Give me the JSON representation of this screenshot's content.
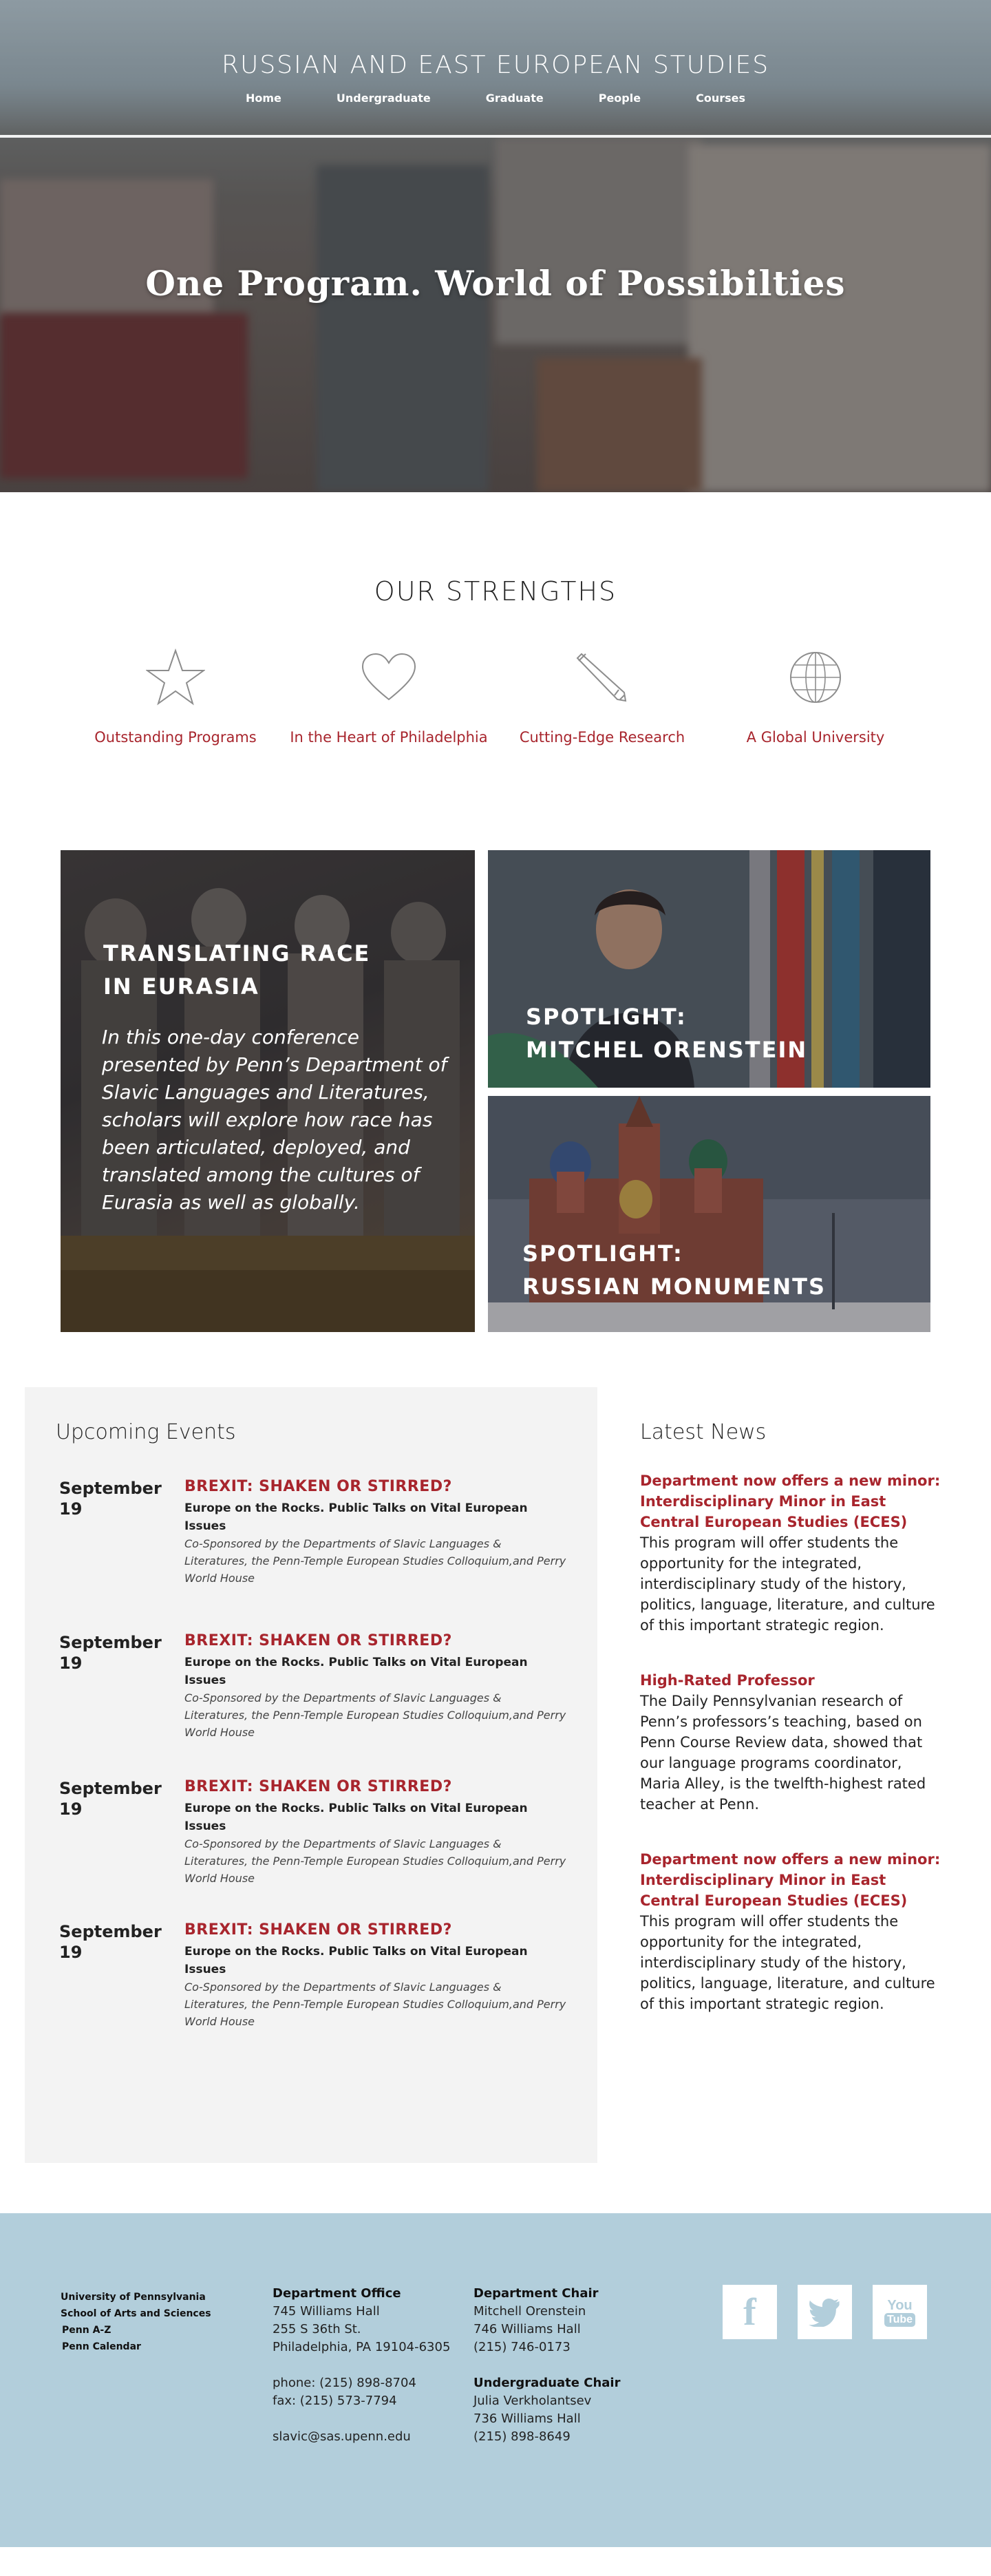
{
  "header": {
    "site_title": "RUSSIAN AND EAST EUROPEAN STUDIES",
    "nav": [
      "Home",
      "Undergraduate",
      "Graduate",
      "People",
      "Courses"
    ],
    "headline": "One Program. World of Possibilties"
  },
  "strengths": {
    "title": "OUR STRENGTHS",
    "items": [
      {
        "icon": "star-icon",
        "label": "Outstanding Programs"
      },
      {
        "icon": "heart-icon",
        "label": "In the Heart of Philadelphia"
      },
      {
        "icon": "pencil-icon",
        "label": "Cutting-Edge Research"
      },
      {
        "icon": "globe-icon",
        "label": "A Global University"
      }
    ]
  },
  "features": {
    "main": {
      "title_line1": "TRANSLATING RACE",
      "title_line2": "IN EURASIA",
      "text": "In this one-day conference presented by Penn’s Department of Slavic Languages and Literatures, scholars will explore how race has been articulated, deployed, and translated among the cultures of Eurasia as well as globally."
    },
    "spotlight1": {
      "line1": "SPOTLIGHT:",
      "line2": "MITCHEL ORENSTEIN"
    },
    "spotlight2": {
      "line1": "SPOTLIGHT:",
      "line2": "RUSSIAN MONUMENTS"
    }
  },
  "events": {
    "title": "Upcoming Events",
    "items": [
      {
        "month": "September",
        "day": "19",
        "title": "BREXIT: SHAKEN OR STIRRED?",
        "subtitle": "Europe on the Rocks. Public Talks on Vital European Issues",
        "note": "Co-Sponsored by the Departments of Slavic Languages & Literatures, the Penn-Temple European Studies Colloquium,and Perry World House"
      },
      {
        "month": "September",
        "day": "19",
        "title": "BREXIT: SHAKEN OR STIRRED?",
        "subtitle": "Europe on the Rocks. Public Talks on Vital European Issues",
        "note": "Co-Sponsored by the Departments of Slavic Languages & Literatures, the Penn-Temple European Studies Colloquium,and Perry World House"
      },
      {
        "month": "September",
        "day": "19",
        "title": "BREXIT: SHAKEN OR STIRRED?",
        "subtitle": "Europe on the Rocks. Public Talks on Vital European Issues",
        "note": "Co-Sponsored by the Departments of Slavic Languages & Literatures, the Penn-Temple European Studies Colloquium,and Perry World House"
      },
      {
        "month": "September",
        "day": "19",
        "title": "BREXIT: SHAKEN OR STIRRED?",
        "subtitle": "Europe on the Rocks. Public Talks on Vital European Issues",
        "note": "Co-Sponsored by the Departments of Slavic Languages & Literatures, the Penn-Temple European Studies Colloquium,and Perry World House"
      }
    ]
  },
  "news": {
    "title": "Latest News",
    "items": [
      {
        "title": "Department now offers a new minor: Interdisciplinary Minor in East Central European Studies (ECES)",
        "text": "This program will offer students the opportunity for the integrated, interdisciplinary study of the history, politics, language, literature, and culture of this important strategic region."
      },
      {
        "title": "High-Rated Professor",
        "text": "The Daily Pennsylvanian research of Penn’s professors’s teaching, based on Penn Course Review data, showed that our language programs coordinator, Maria Alley, is the twelfth-highest rated teacher at Penn."
      },
      {
        "title": "Department now offers a new minor: Interdisciplinary Minor in East Central European Studies (ECES)",
        "text": "This program will offer students the opportunity for the integrated, interdisciplinary study of the history, politics, language, literature, and culture of this important strategic region."
      }
    ]
  },
  "footer": {
    "links": [
      "University of Pennsylvania",
      "School of Arts and Sciences",
      "Penn A-Z",
      "Penn Calendar"
    ],
    "office": {
      "heading": "Department Office",
      "address": [
        "745 Williams Hall",
        "255 S 36th St.",
        "Philadelphia, PA 19104-6305"
      ],
      "phone": "phone: (215) 898-8704",
      "fax": "fax: (215) 573-7794",
      "email": "slavic@sas.upenn.edu"
    },
    "chair": {
      "heading": "Department Chair",
      "lines": [
        "Mitchell Orenstein",
        "746 Williams Hall",
        "(215) 746-0173"
      ]
    },
    "ug_chair": {
      "heading": "Undergraduate Chair",
      "lines": [
        "Julia Verkholantsev",
        "736 Williams Hall",
        "(215) 898-8649"
      ]
    },
    "socials": [
      {
        "icon": "facebook-icon",
        "glyph": "f"
      },
      {
        "icon": "twitter-icon",
        "glyph": ""
      },
      {
        "icon": "youtube-icon",
        "glyph_top": "You",
        "glyph_bottom": "Tube"
      }
    ],
    "social_icon_color": "#b2cedb"
  },
  "colors": {
    "accent": "#a8252d",
    "footer_bg": "#b2cedb",
    "events_bg": "#f3f3f3"
  }
}
